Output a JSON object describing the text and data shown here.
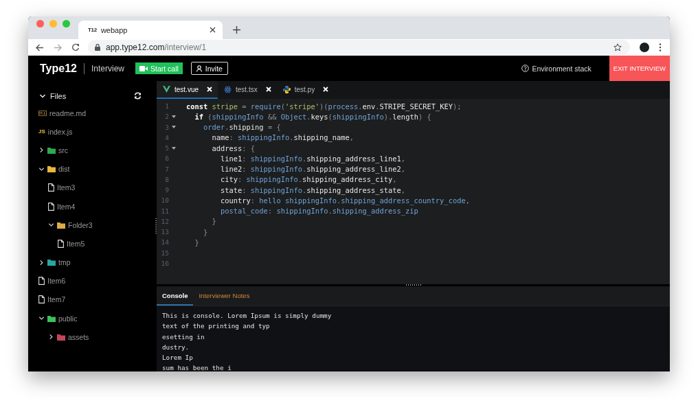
{
  "browser": {
    "tab": {
      "favicon": "T12",
      "title": "webapp"
    },
    "url": {
      "host": "app.type12.com",
      "path": "/interview/1"
    }
  },
  "header": {
    "logo": "Type12",
    "section": "Interview",
    "start_call": "Start call",
    "invite": "Invite",
    "environment": "Environment stack",
    "exit": "EXIT INTERVIEW"
  },
  "sidebar": {
    "title": "Files",
    "expanded": true,
    "items": [
      {
        "name": "readme.md",
        "kind": "readme"
      },
      {
        "name": "index.js",
        "kind": "js",
        "badge": "JS"
      },
      {
        "name": "src",
        "kind": "folder",
        "color": "#2fa84f",
        "expanded": false
      },
      {
        "name": "dist",
        "kind": "folder",
        "color": "#e8b83a",
        "expanded": true,
        "children": [
          {
            "name": "Item3",
            "kind": "file"
          },
          {
            "name": "Item4",
            "kind": "file"
          },
          {
            "name": "Folder3",
            "kind": "folder",
            "color": "#e0a94a",
            "expanded": true,
            "children": [
              {
                "name": "Item5",
                "kind": "file"
              }
            ]
          }
        ]
      },
      {
        "name": "tmp",
        "kind": "folder",
        "color": "#2aa6a0",
        "expanded": false
      },
      {
        "name": "Item6",
        "kind": "file"
      },
      {
        "name": "Item7",
        "kind": "file"
      },
      {
        "name": "public",
        "kind": "folder",
        "color": "#3cbf5a",
        "expanded": true,
        "children": [
          {
            "name": "assets",
            "kind": "folder",
            "color": "#c2455c",
            "expanded": false
          }
        ]
      }
    ]
  },
  "editor": {
    "tabs": [
      {
        "label": "test.vue",
        "kind": "vue",
        "selected": true
      },
      {
        "label": "test.tsx",
        "kind": "react",
        "selected": false
      },
      {
        "label": "test.py",
        "kind": "python",
        "selected": false
      }
    ],
    "lines": [
      {
        "number": "1",
        "fold": false,
        "tokens": [
          {
            "kind": "keyword",
            "text": "const"
          },
          {
            "kind": "green",
            "text": " stripe"
          },
          {
            "kind": "punct",
            "text": " = "
          },
          {
            "kind": "blue",
            "text": "require"
          },
          {
            "kind": "punct",
            "text": "("
          },
          {
            "kind": "green",
            "text": "'stripe'"
          },
          {
            "kind": "punct",
            "text": ")("
          },
          {
            "kind": "blue",
            "text": "process"
          },
          {
            "kind": "punct",
            "text": "."
          },
          {
            "kind": "plain",
            "text": "env"
          },
          {
            "kind": "punct",
            "text": "."
          },
          {
            "kind": "plain",
            "text": "STRIPE_SECRET_KEY"
          },
          {
            "kind": "punct",
            "text": ");"
          }
        ]
      },
      {
        "number": "2",
        "fold": true,
        "tokens": [
          {
            "kind": "keyword",
            "text": "  if"
          },
          {
            "kind": "punct",
            "text": " ("
          },
          {
            "kind": "blue",
            "text": "shippingInfo"
          },
          {
            "kind": "punct",
            "text": " && "
          },
          {
            "kind": "blue",
            "text": "Object"
          },
          {
            "kind": "punct",
            "text": "."
          },
          {
            "kind": "plain",
            "text": "keys"
          },
          {
            "kind": "punct",
            "text": "("
          },
          {
            "kind": "blue",
            "text": "shippingInfo"
          },
          {
            "kind": "punct",
            "text": ")."
          },
          {
            "kind": "plain",
            "text": "length"
          },
          {
            "kind": "punct",
            "text": ") {"
          }
        ]
      },
      {
        "number": "3",
        "fold": true,
        "tokens": [
          {
            "kind": "blue",
            "text": "    order"
          },
          {
            "kind": "punct",
            "text": "."
          },
          {
            "kind": "plain",
            "text": "shipping"
          },
          {
            "kind": "punct",
            "text": " = {"
          }
        ]
      },
      {
        "number": "4",
        "fold": false,
        "tokens": [
          {
            "kind": "plain",
            "text": "      name"
          },
          {
            "kind": "punct",
            "text": ": "
          },
          {
            "kind": "blue",
            "text": "shippingInfo"
          },
          {
            "kind": "punct",
            "text": "."
          },
          {
            "kind": "plain",
            "text": "shipping_name"
          },
          {
            "kind": "punct",
            "text": ","
          }
        ]
      },
      {
        "number": "5",
        "fold": true,
        "tokens": [
          {
            "kind": "plain",
            "text": "      address"
          },
          {
            "kind": "punct",
            "text": ": {"
          }
        ]
      },
      {
        "number": "6",
        "fold": false,
        "tokens": [
          {
            "kind": "plain",
            "text": "        line1"
          },
          {
            "kind": "punct",
            "text": ": "
          },
          {
            "kind": "blue",
            "text": "shippingInfo"
          },
          {
            "kind": "punct",
            "text": "."
          },
          {
            "kind": "plain",
            "text": "shipping_address_line1"
          },
          {
            "kind": "punct",
            "text": ","
          }
        ]
      },
      {
        "number": "7",
        "fold": false,
        "tokens": [
          {
            "kind": "plain",
            "text": "        line2"
          },
          {
            "kind": "punct",
            "text": ": "
          },
          {
            "kind": "blue",
            "text": "shippingInfo"
          },
          {
            "kind": "punct",
            "text": "."
          },
          {
            "kind": "plain",
            "text": "shipping_address_line2"
          },
          {
            "kind": "punct",
            "text": ","
          }
        ]
      },
      {
        "number": "8",
        "fold": false,
        "tokens": [
          {
            "kind": "plain",
            "text": "        city"
          },
          {
            "kind": "punct",
            "text": ": "
          },
          {
            "kind": "blue",
            "text": "shippingInfo"
          },
          {
            "kind": "punct",
            "text": "."
          },
          {
            "kind": "plain",
            "text": "shipping_address_city"
          },
          {
            "kind": "punct",
            "text": ","
          }
        ]
      },
      {
        "number": "9",
        "fold": false,
        "tokens": [
          {
            "kind": "plain",
            "text": "        state"
          },
          {
            "kind": "punct",
            "text": ": "
          },
          {
            "kind": "blue",
            "text": "shippingInfo"
          },
          {
            "kind": "punct",
            "text": "."
          },
          {
            "kind": "plain",
            "text": "shipping_address_state"
          },
          {
            "kind": "punct",
            "text": ","
          }
        ]
      },
      {
        "number": "10",
        "fold": false,
        "tokens": [
          {
            "kind": "plain",
            "text": "        country"
          },
          {
            "kind": "punct",
            "text": ": "
          },
          {
            "kind": "blue",
            "text": "hello shippingInfo"
          },
          {
            "kind": "punct",
            "text": "."
          },
          {
            "kind": "blue",
            "text": "shipping_address_country_code"
          },
          {
            "kind": "punct",
            "text": ","
          }
        ]
      },
      {
        "number": "11",
        "fold": false,
        "tokens": [
          {
            "kind": "blue",
            "text": "        postal_code"
          },
          {
            "kind": "punct",
            "text": ": "
          },
          {
            "kind": "blue",
            "text": "shippingInfo"
          },
          {
            "kind": "punct",
            "text": "."
          },
          {
            "kind": "blue",
            "text": "shipping_address_zip"
          }
        ]
      },
      {
        "number": "12",
        "fold": false,
        "tokens": [
          {
            "kind": "punct",
            "text": "      }"
          }
        ]
      },
      {
        "number": "13",
        "fold": false,
        "tokens": [
          {
            "kind": "punct",
            "text": "    }"
          }
        ]
      },
      {
        "number": "14",
        "fold": false,
        "tokens": [
          {
            "kind": "punct",
            "text": "  }"
          }
        ]
      },
      {
        "number": "15",
        "fold": false
      },
      {
        "number": "16",
        "fold": false
      }
    ]
  },
  "panel": {
    "tabs": [
      {
        "label": "Console",
        "selected": true
      },
      {
        "label": "Interviewer Notes",
        "selected": false
      }
    ],
    "console": [
      "This is console. Lorem Ipsum is simply dummy",
      "text of the printing and typ",
      "esetting in",
      "dustry.",
      "Lorem Ip",
      "sum has been the i"
    ]
  }
}
